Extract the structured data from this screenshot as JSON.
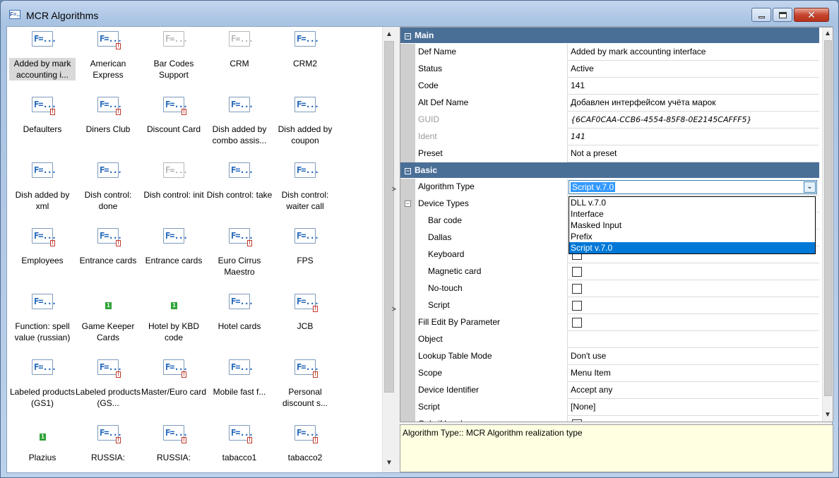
{
  "window": {
    "title": "MCR Algorithms",
    "app_icon": "F=..",
    "close_glyph": "✕"
  },
  "icon_list": {
    "items": [
      {
        "label": "Added by mark accounting i...",
        "icon": "f-icon",
        "selected": true
      },
      {
        "label": "American Express",
        "icon": "f-icon-badge"
      },
      {
        "label": "Bar Codes Support",
        "icon": "f-icon-gray"
      },
      {
        "label": "CRM",
        "icon": "f-icon-gray"
      },
      {
        "label": "CRM2",
        "icon": "f-icon"
      },
      {
        "label": "Defaulters",
        "icon": "f-icon-badge"
      },
      {
        "label": "Diners Club",
        "icon": "f-icon-badge"
      },
      {
        "label": "Discount Card",
        "icon": "f-icon-badge"
      },
      {
        "label": "Dish added by combo assis...",
        "icon": "f-icon"
      },
      {
        "label": "Dish added by coupon",
        "icon": "f-icon"
      },
      {
        "label": "Dish added by xml",
        "icon": "f-icon"
      },
      {
        "label": "Dish control: done",
        "icon": "f-icon"
      },
      {
        "label": "Dish control: init",
        "icon": "f-icon-gray"
      },
      {
        "label": "Dish control: take",
        "icon": "f-icon"
      },
      {
        "label": "Dish control: waiter call",
        "icon": "f-icon"
      },
      {
        "label": "Employees",
        "icon": "f-icon-badge"
      },
      {
        "label": "Entrance cards",
        "icon": "f-icon-badge"
      },
      {
        "label": "Entrance cards",
        "icon": "f-icon"
      },
      {
        "label": "Euro Cirrus Maestro",
        "icon": "f-icon-badge"
      },
      {
        "label": "FPS",
        "icon": "f-icon"
      },
      {
        "label": "Function: spell value (russian)",
        "icon": "f-icon"
      },
      {
        "label": "Game Keeper Cards",
        "icon": "green-mark"
      },
      {
        "label": "Hotel by KBD code",
        "icon": "green-mark"
      },
      {
        "label": "Hotel cards",
        "icon": "f-icon"
      },
      {
        "label": "JCB",
        "icon": "f-icon-badge"
      },
      {
        "label": "Labeled products (GS1)",
        "icon": "f-icon"
      },
      {
        "label": "Labeled products (GS...",
        "icon": "f-icon-badge"
      },
      {
        "label": "Master/Euro card",
        "icon": "f-icon-badge"
      },
      {
        "label": "Mobile fast f...",
        "icon": "f-icon"
      },
      {
        "label": "Personal discount s...",
        "icon": "f-icon-badge"
      },
      {
        "label": "Plazius",
        "icon": "green-mark"
      },
      {
        "label": "RUSSIA:",
        "icon": "f-icon-badge"
      },
      {
        "label": "RUSSIA:",
        "icon": "f-icon-badge"
      },
      {
        "label": "tabacco1",
        "icon": "f-icon-badge"
      },
      {
        "label": "tabacco2",
        "icon": "f-icon-badge"
      }
    ],
    "icon_text": "F=...",
    "badge_text": "!",
    "green_text": "1"
  },
  "property_grid": {
    "main_category": "Main",
    "basic_category": "Basic",
    "main": [
      {
        "name": "Def Name",
        "value": "Added by mark accounting interface"
      },
      {
        "name": "Status",
        "value": "Active"
      },
      {
        "name": "Code",
        "value": "141"
      },
      {
        "name": "Alt Def Name",
        "value": "Добавлен интерфейсом учёта марок"
      },
      {
        "name": "GUID",
        "value": "{6CAF0CAA-CCB6-4554-85F8-0E2145CAFFF5}",
        "disabled": true
      },
      {
        "name": "Ident",
        "value": "141",
        "disabled": true
      },
      {
        "name": "Preset",
        "value": "Not a preset"
      }
    ],
    "algorithm_type": {
      "name": "Algorithm Type",
      "value": "Script v.7.0"
    },
    "device_types": {
      "name": "Device Types",
      "value": ""
    },
    "devices": [
      {
        "name": "Bar code"
      },
      {
        "name": "Dallas"
      },
      {
        "name": "Keyboard"
      },
      {
        "name": "Magnetic card"
      },
      {
        "name": "No-touch"
      },
      {
        "name": "Script"
      }
    ],
    "rest": [
      {
        "name": "Fill Edit By Parameter",
        "value": ""
      },
      {
        "name": "Object",
        "value": ""
      },
      {
        "name": "Lookup Table Mode",
        "value": "Don't use"
      },
      {
        "name": "Scope",
        "value": "Menu Item"
      },
      {
        "name": "Device Identifier",
        "value": "Accept any"
      },
      {
        "name": "Script",
        "value": "[None]"
      },
      {
        "name": "Only if lonely",
        "value": ""
      }
    ],
    "dropdown_options": [
      "DLL v.7.0",
      "Interface",
      "Masked Input",
      "Prefix",
      "Script v.7.0"
    ],
    "dropdown_selected": "Script v.7.0"
  },
  "help_text": "Algorithm Type:: MCR Algorithm realization type"
}
